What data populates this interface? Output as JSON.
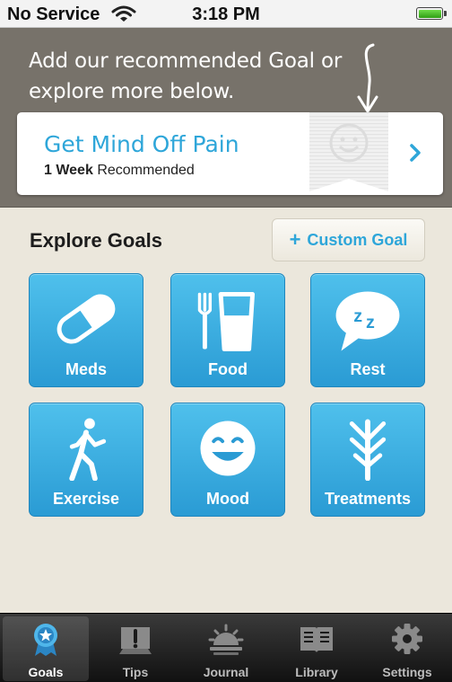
{
  "status_bar": {
    "carrier": "No Service",
    "time": "3:18 PM"
  },
  "banner": {
    "text": "Add our recommended Goal or explore more below.",
    "card": {
      "title": "Get Mind Off Pain",
      "duration": "1 Week",
      "suffix": "Recommended"
    }
  },
  "explore": {
    "title": "Explore Goals",
    "custom_goal_label": "Custom Goal",
    "tiles": [
      {
        "label": "Meds",
        "icon": "pill-icon"
      },
      {
        "label": "Food",
        "icon": "fork-glass-icon"
      },
      {
        "label": "Rest",
        "icon": "sleep-bubble-icon"
      },
      {
        "label": "Exercise",
        "icon": "walking-person-icon"
      },
      {
        "label": "Mood",
        "icon": "smiley-icon"
      },
      {
        "label": "Treatments",
        "icon": "branch-icon"
      }
    ]
  },
  "tab_bar": {
    "active": "Goals",
    "tabs": [
      {
        "label": "Goals",
        "icon": "badge-star-icon"
      },
      {
        "label": "Tips",
        "icon": "tips-exclamation-icon"
      },
      {
        "label": "Journal",
        "icon": "sunrise-icon"
      },
      {
        "label": "Library",
        "icon": "book-icon"
      },
      {
        "label": "Settings",
        "icon": "gear-icon"
      }
    ]
  },
  "colors": {
    "accent": "#2ea6d9",
    "tile": "#3aaee2",
    "banner": "#77726a",
    "background": "#ebe7dc"
  }
}
